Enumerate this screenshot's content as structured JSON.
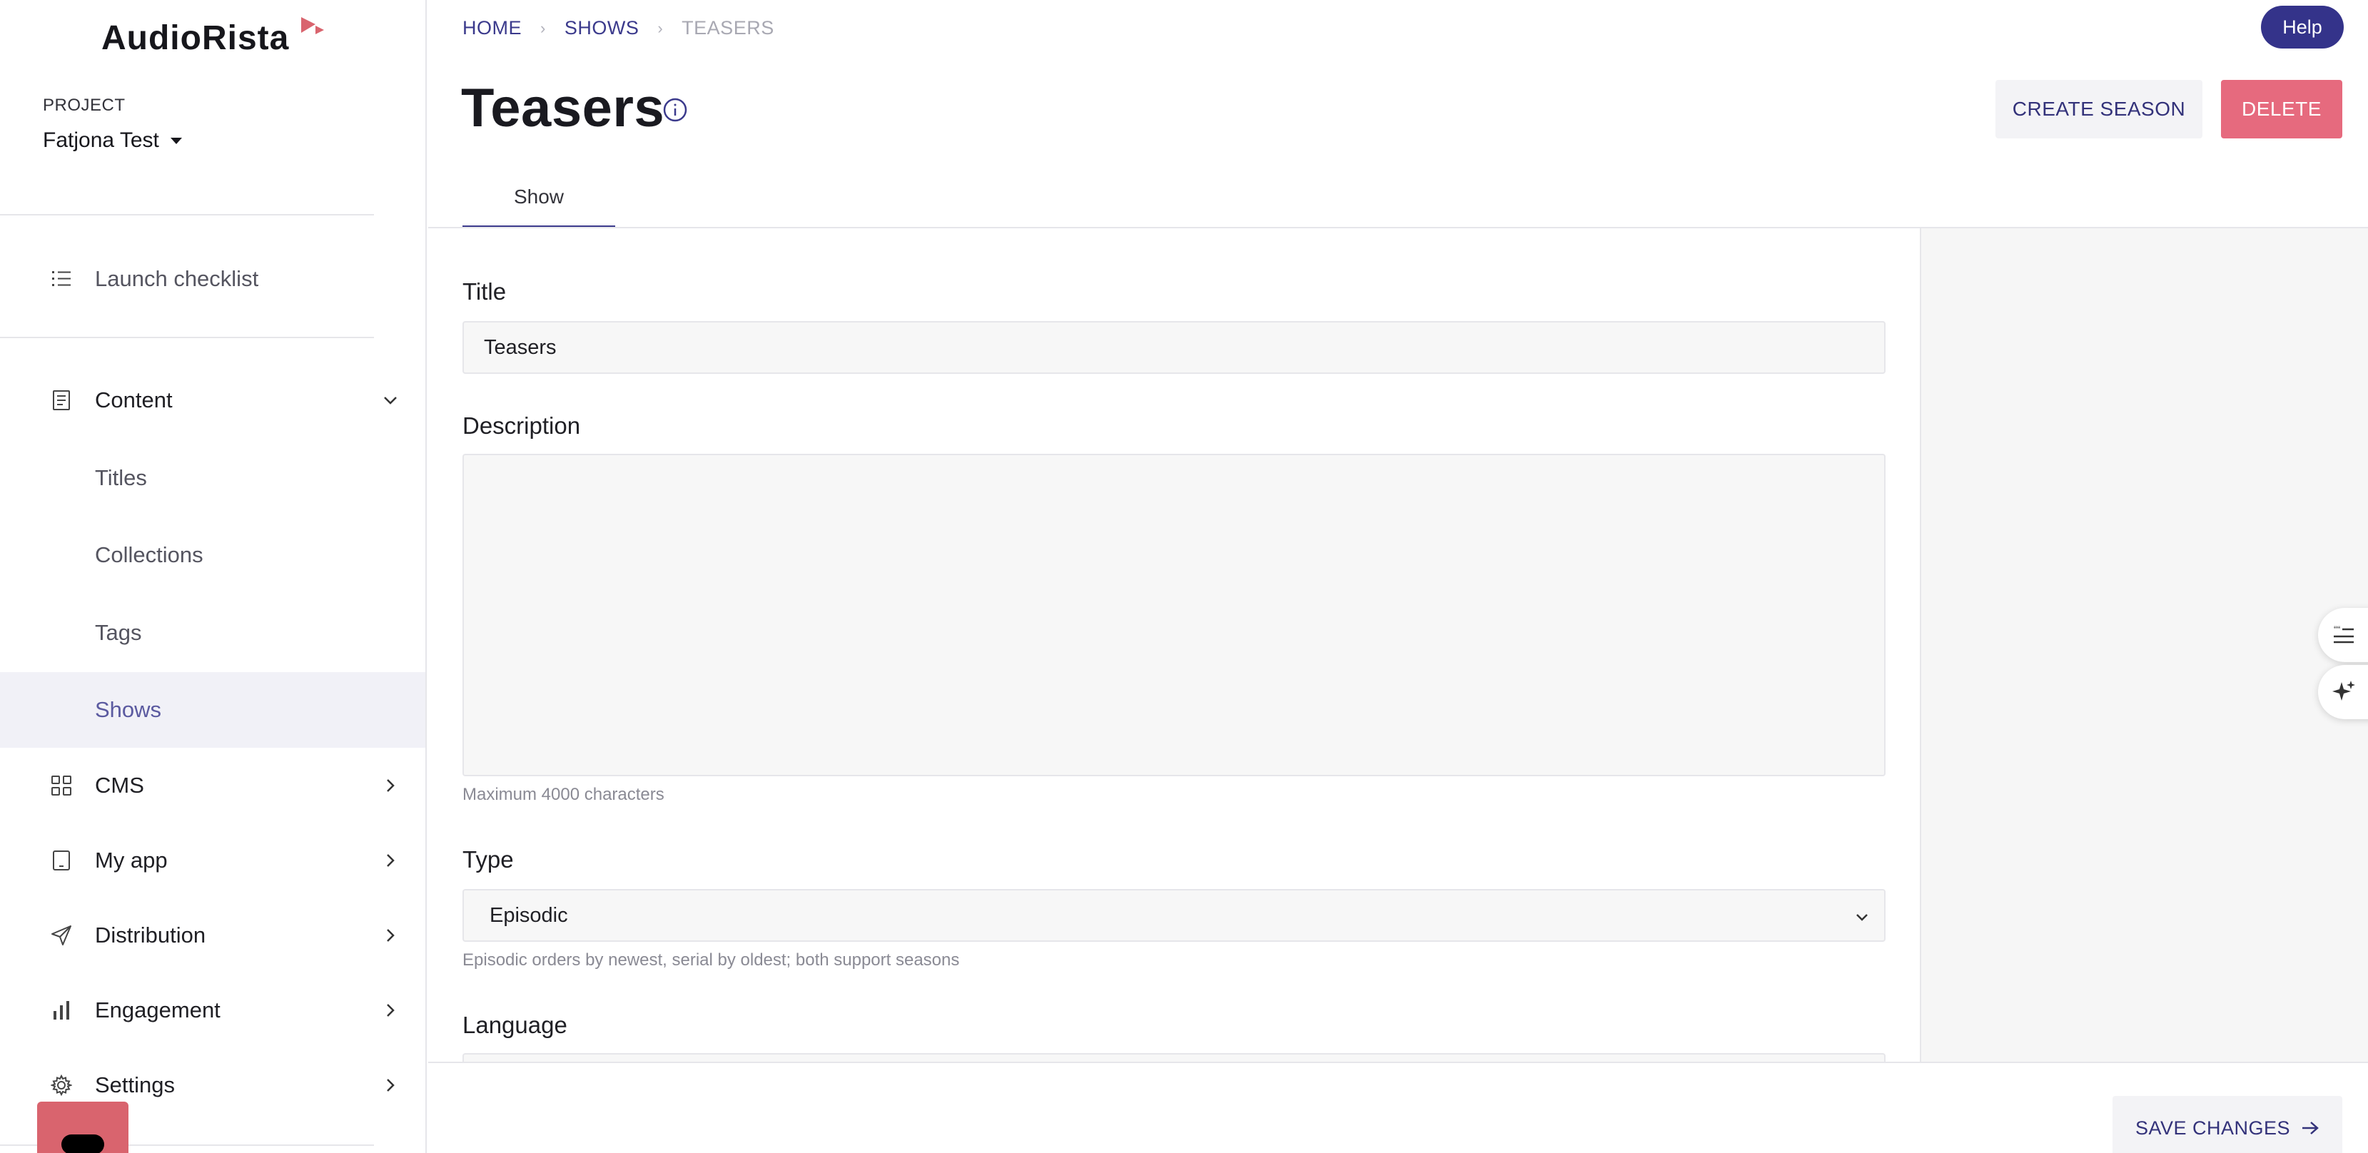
{
  "app": {
    "logo_text": "AudioRista",
    "accent": "#34338a",
    "danger": "#e66a7e",
    "brand_mark_color": "#d9646e"
  },
  "sidebar": {
    "project_label": "PROJECT",
    "project_name": "Fatjona Test",
    "launch_checklist": "Launch checklist",
    "content": {
      "label": "Content",
      "expanded": true,
      "items": [
        {
          "label": "Titles",
          "active": false
        },
        {
          "label": "Collections",
          "active": false
        },
        {
          "label": "Tags",
          "active": false
        },
        {
          "label": "Shows",
          "active": true
        }
      ]
    },
    "sections": [
      {
        "label": "CMS",
        "icon": "grid-icon"
      },
      {
        "label": "My app",
        "icon": "tablet-icon"
      },
      {
        "label": "Distribution",
        "icon": "send-icon"
      },
      {
        "label": "Engagement",
        "icon": "bar-chart-icon"
      },
      {
        "label": "Settings",
        "icon": "gear-icon"
      }
    ]
  },
  "breadcrumb": [
    {
      "label": "HOME"
    },
    {
      "label": "SHOWS"
    },
    {
      "label": "TEASERS"
    }
  ],
  "header": {
    "help_label": "Help",
    "title": "Teasers",
    "create_season_label": "CREATE SEASON",
    "delete_label": "DELETE"
  },
  "tabs": [
    {
      "label": "Show",
      "active": true
    }
  ],
  "form": {
    "title_label": "Title",
    "title_value": "Teasers",
    "description_label": "Description",
    "description_value": "",
    "description_hint": "Maximum 4000 characters",
    "type_label": "Type",
    "type_value": "Episodic",
    "type_hint": "Episodic orders by newest, serial by oldest; both support seasons",
    "language_label": "Language"
  },
  "footer": {
    "save_label": "SAVE CHANGES"
  }
}
